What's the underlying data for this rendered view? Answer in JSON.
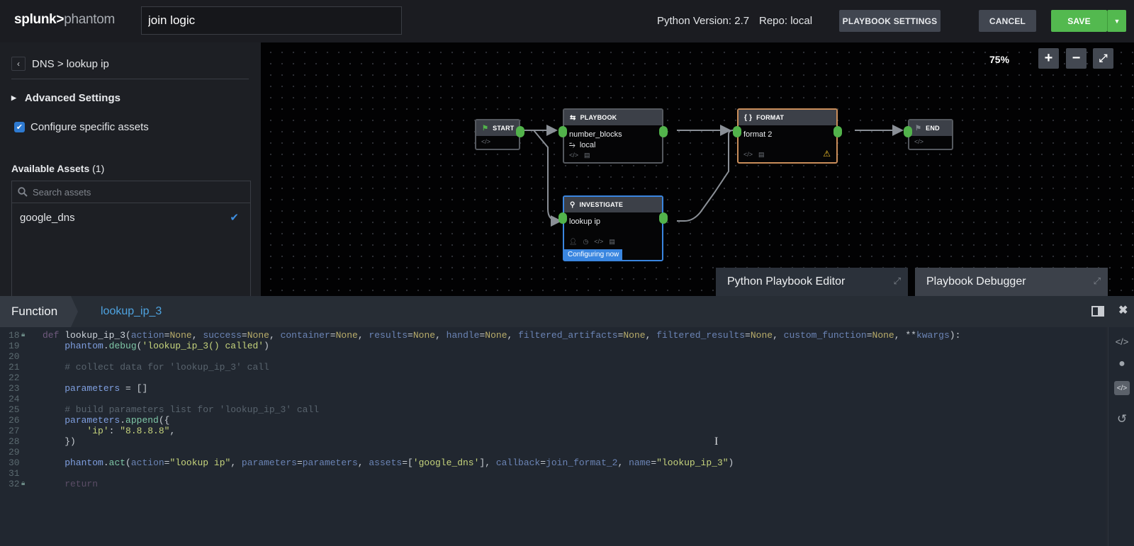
{
  "header": {
    "logo_bold": "splunk>",
    "logo_light": "phantom",
    "playbook_name": "join logic",
    "python_version": "Python Version: 2.7",
    "repo": "Repo: local",
    "playbook_settings_label": "PLAYBOOK SETTINGS",
    "cancel_label": "CANCEL",
    "save_label": "SAVE"
  },
  "left_panel": {
    "back_icon": "chevron-left-icon",
    "breadcrumb": "DNS > lookup ip",
    "advanced_settings_label": "Advanced Settings",
    "configure_assets_label": "Configure specific assets",
    "configure_assets_checked": true,
    "available_assets_label": "Available Assets",
    "available_assets_count": "(1)",
    "search_placeholder": "Search assets",
    "assets": [
      {
        "name": "google_dns",
        "selected": true
      }
    ]
  },
  "canvas": {
    "zoom_level": "75%",
    "zoom_in": "+",
    "zoom_out": "−",
    "fit_icon": "expand-icon",
    "nodes": {
      "start": {
        "type": "START",
        "icon": "flag-icon"
      },
      "playbook": {
        "type": "PLAYBOOK",
        "icon": "playbook-icon",
        "name": "number_blocks",
        "repo": "local"
      },
      "format": {
        "type": "FORMAT",
        "icon": "braces-icon",
        "name": "format 2",
        "warning": true
      },
      "end": {
        "type": "END",
        "icon": "flag-icon"
      },
      "investigate": {
        "type": "INVESTIGATE",
        "icon": "search-icon",
        "name": "lookup ip",
        "status": "Configuring now"
      }
    },
    "colors": {
      "port": "#52b34b",
      "format_border": "#c98d5a",
      "investigate_border": "#3a86e0",
      "warning": "#f0c02a"
    }
  },
  "tabs": {
    "python_editor": "Python Playbook Editor",
    "debugger": "Playbook Debugger"
  },
  "editor": {
    "section_label": "Function",
    "function_name": "lookup_ip_3",
    "lines": [
      {
        "n": "18",
        "locked": true
      },
      {
        "n": "19"
      },
      {
        "n": "20"
      },
      {
        "n": "21"
      },
      {
        "n": "22"
      },
      {
        "n": "23"
      },
      {
        "n": "24"
      },
      {
        "n": "25"
      },
      {
        "n": "26"
      },
      {
        "n": "27"
      },
      {
        "n": "28"
      },
      {
        "n": "29"
      },
      {
        "n": "30"
      },
      {
        "n": "31"
      },
      {
        "n": "32",
        "locked": true
      }
    ],
    "code": {
      "l18": "def lookup_ip_3(action=None, success=None, container=None, results=None, handle=None, filtered_artifacts=None, filtered_results=None, custom_function=None, **kwargs):",
      "l19": "    phantom.debug('lookup_ip_3() called')",
      "l21": "    # collect data for 'lookup_ip_3' call",
      "l23": "    parameters = []",
      "l25": "    # build parameters list for 'lookup_ip_3' call",
      "l26": "    parameters.append({",
      "l27": "        'ip': \"8.8.8.8\",",
      "l28": "    })",
      "l30": "    phantom.act(action=\"lookup ip\", parameters=parameters, assets=['google_dns'], callback=join_format_2, name=\"lookup_ip_3\")",
      "l32": "    return"
    },
    "side_tools": [
      "code-icon",
      "globe-icon",
      "code-box-icon",
      "undo-icon"
    ]
  }
}
